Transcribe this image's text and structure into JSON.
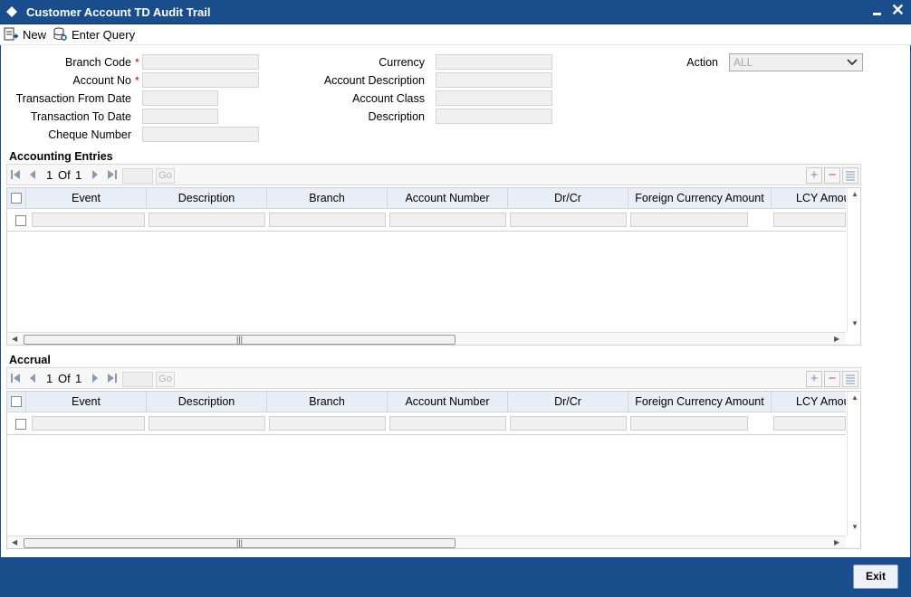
{
  "window": {
    "title": "Customer Account TD Audit Trail"
  },
  "toolbar": {
    "new_label": "New",
    "enter_query_label": "Enter Query"
  },
  "form": {
    "branch_code_label": "Branch Code",
    "account_no_label": "Account No",
    "txn_from_date_label": "Transaction From Date",
    "txn_to_date_label": "Transaction To Date",
    "cheque_number_label": "Cheque Number",
    "currency_label": "Currency",
    "account_description_label": "Account Description",
    "account_class_label": "Account Class",
    "description_label": "Description",
    "action_label": "Action",
    "action_value": "ALL",
    "required_marker": "*"
  },
  "accounting_entries": {
    "title": "Accounting Entries",
    "pager": {
      "current": "1",
      "of_label": "Of",
      "total": "1",
      "go_label": "Go"
    },
    "columns": [
      "Event",
      "Description",
      "Branch",
      "Account Number",
      "Dr/Cr",
      "Foreign Currency Amount",
      "LCY Amou"
    ]
  },
  "accrual": {
    "title": "Accrual",
    "pager": {
      "current": "1",
      "of_label": "Of",
      "total": "1",
      "go_label": "Go"
    },
    "columns": [
      "Event",
      "Description",
      "Branch",
      "Account Number",
      "Dr/Cr",
      "Foreign Currency Amount",
      "LCY Amou"
    ]
  },
  "footer": {
    "exit_label": "Exit"
  },
  "colors": {
    "title_bar": "#1a4d8c",
    "required": "#c00000",
    "grid_header": "#e9eef6"
  }
}
